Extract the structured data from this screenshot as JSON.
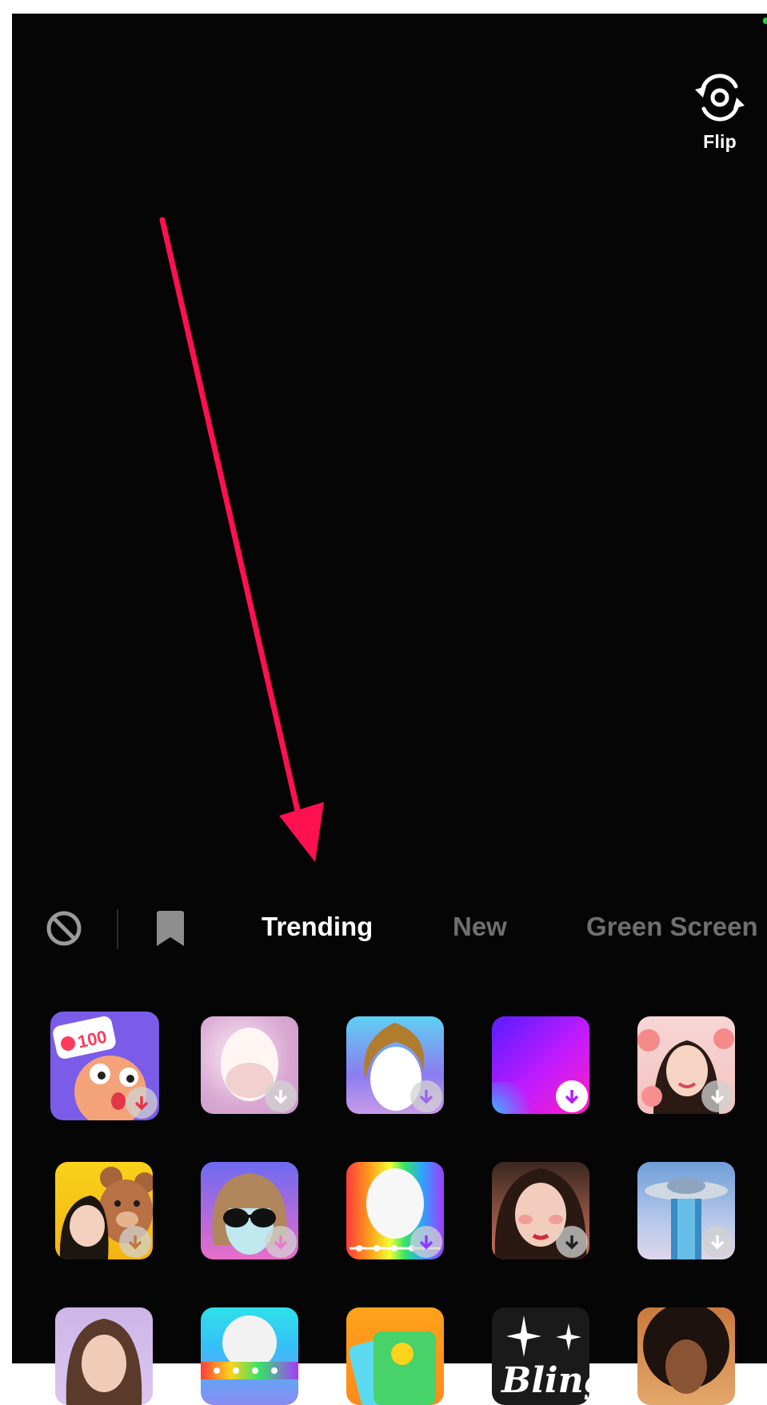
{
  "camera": {
    "flip_label": "Flip",
    "flip_icon": "camera-flip-icon"
  },
  "effects_bar": {
    "no_effect_icon": "no-effect-icon",
    "favorites_icon": "bookmark-icon",
    "tabs": [
      {
        "label": "Trending",
        "active": true
      },
      {
        "label": "New",
        "active": false
      },
      {
        "label": "Green Screen",
        "active": false
      }
    ]
  },
  "annotation": {
    "arrow_color": "#ff1150",
    "target": "tab-trending"
  },
  "colors": {
    "background": "#050505",
    "tab_active": "#ffffff",
    "tab_inactive": "#6f6f6f"
  },
  "effects_grid": {
    "rows": [
      [
        {
          "name": "100-likes-emoji",
          "badge_text": "100",
          "download_icon": true
        },
        {
          "name": "glow-face",
          "download_icon": true
        },
        {
          "name": "hair-face",
          "download_icon": true
        },
        {
          "name": "purple-gradient",
          "download_icon": true
        },
        {
          "name": "peach-girl",
          "download_icon": true
        }
      ],
      [
        {
          "name": "teddy-bear-girl",
          "download_icon": true
        },
        {
          "name": "sunglasses-bob",
          "download_icon": true
        },
        {
          "name": "rainbow-face",
          "download_icon": true
        },
        {
          "name": "blush-girl",
          "download_icon": true
        },
        {
          "name": "ufo-tower",
          "download_icon": true
        }
      ],
      [
        {
          "name": "long-hair-girl",
          "download_icon": false
        },
        {
          "name": "rainbow-bar",
          "download_icon": false
        },
        {
          "name": "photo-gallery",
          "download_icon": false
        },
        {
          "name": "bling-sparkle",
          "text": "Bling",
          "download_icon": false
        },
        {
          "name": "curly-hair-woman",
          "download_icon": false
        }
      ]
    ]
  }
}
